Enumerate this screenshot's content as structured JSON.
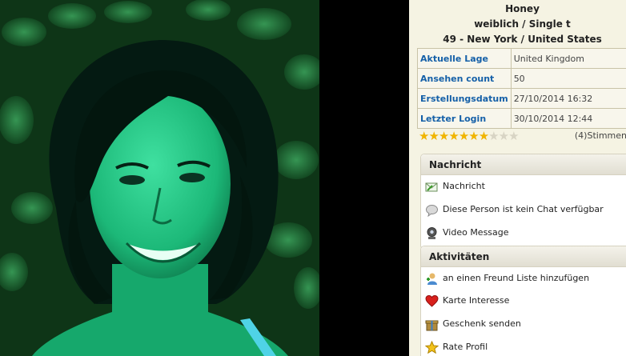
{
  "profile": {
    "name": "Honey",
    "gender_status": "weiblich / Single t",
    "age_location": "49 - New York / United States"
  },
  "info_rows": [
    {
      "key": "Aktuelle Lage",
      "value": "United Kingdom"
    },
    {
      "key": "Ansehen count",
      "value": "50"
    },
    {
      "key": "Erstellungsdatum",
      "value": "27/10/2014 16:32"
    },
    {
      "key": "Letzter Login",
      "value": "30/10/2014 12:44"
    }
  ],
  "rating": {
    "filled_stars": 7,
    "total_stars": 10,
    "votes_text": "(4)Stimmen"
  },
  "sections": {
    "message": {
      "title": "Nachricht",
      "items": [
        "Nachricht",
        "Diese Person ist kein Chat verfügbar",
        "Video Message"
      ]
    },
    "activities": {
      "title": "Aktivitäten",
      "items": [
        "an einen Freund Liste hinzufügen",
        "Karte Interesse",
        "Geschenk senden",
        "Rate Profil"
      ]
    }
  },
  "colors": {
    "panel_bg": "#f5f3e3",
    "label_blue": "#1560a8",
    "star": "#f0b400",
    "photo_tint": "#1fbf7a"
  }
}
